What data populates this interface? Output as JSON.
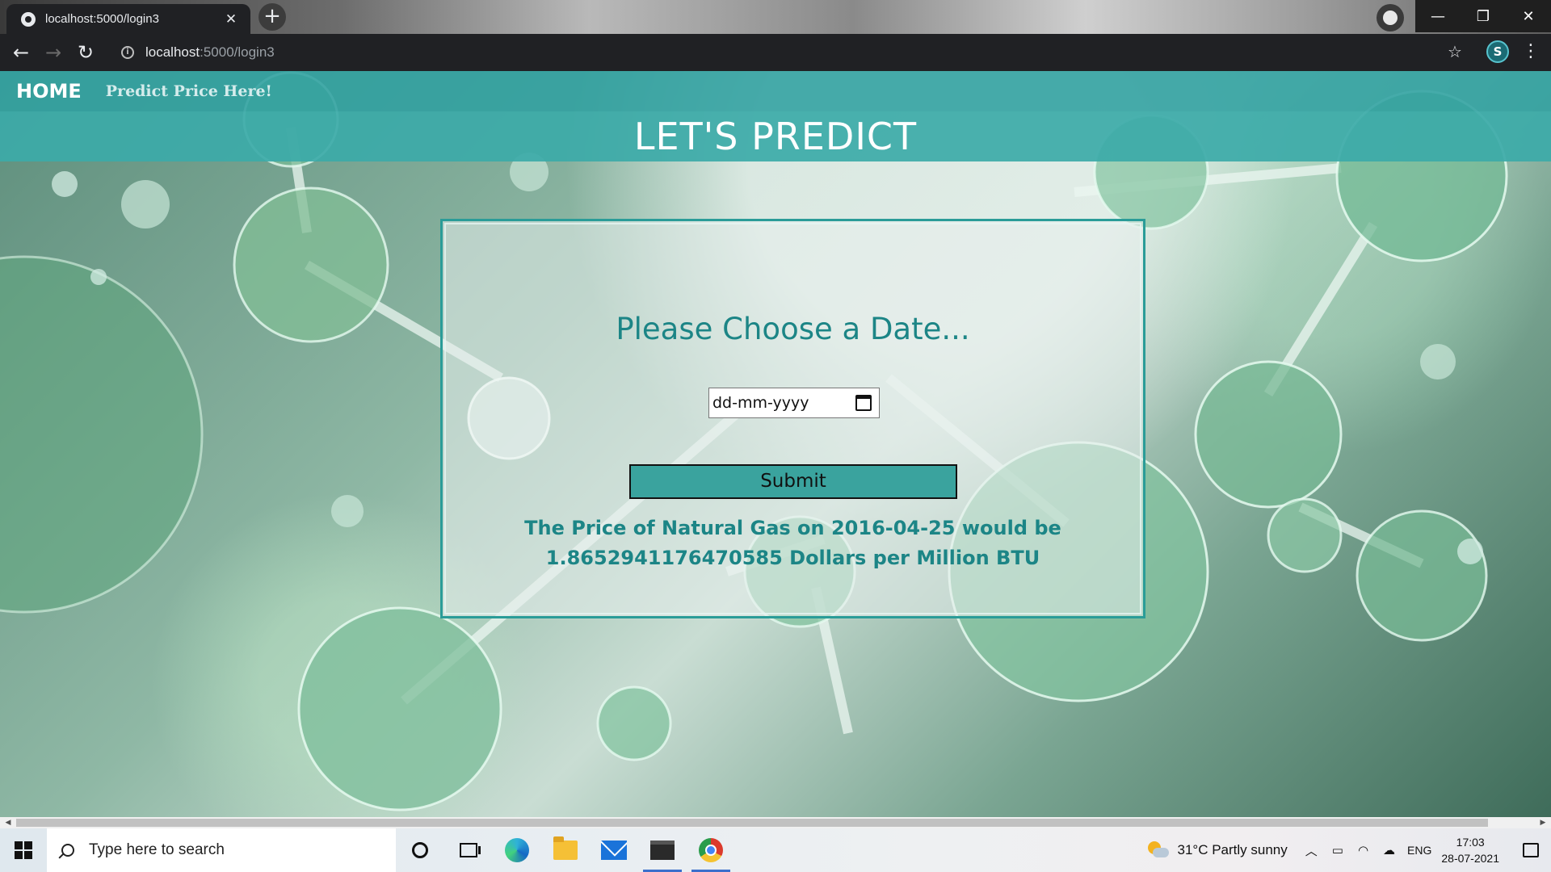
{
  "browser": {
    "tab_title": "localhost:5000/login3",
    "tab_close": "✕",
    "new_tab": "+",
    "url_host": "localhost",
    "url_rest": ":5000/login3",
    "profile_initial": "S",
    "window_controls": [
      "—",
      "❐",
      "✕"
    ]
  },
  "navbar": {
    "home_label": "HOME",
    "predict_link_label": "Predict Price Here!"
  },
  "banner": {
    "title": "LET'S PREDICT"
  },
  "form": {
    "heading": "Please Choose a Date...",
    "date_placeholder": "dd-mm-yyyy",
    "submit_label": "Submit",
    "result_text": "The Price of Natural Gas on 2016-04-25 would be 1.8652941176470585 Dollars per Million BTU"
  },
  "taskbar": {
    "search_placeholder": "Type here to search",
    "weather": "31°C  Partly sunny",
    "language": "ENG",
    "time": "17:03",
    "date": "28-07-2021"
  },
  "colors": {
    "accent_teal": "#30a0a0",
    "heading_teal": "#1c8586",
    "button_teal": "#3aa39e"
  },
  "icons": {
    "tray": [
      "chevron-up-icon",
      "battery-icon",
      "wifi-icon",
      "onedrive-icon"
    ]
  }
}
